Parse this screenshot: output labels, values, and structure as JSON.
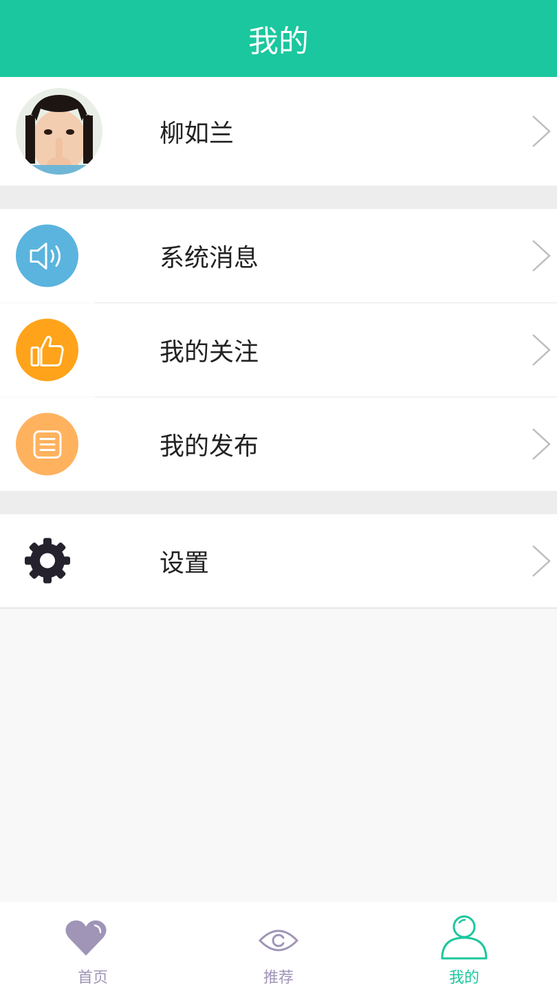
{
  "header": {
    "title": "我的"
  },
  "profile": {
    "name": "柳如兰"
  },
  "menu": [
    {
      "label": "系统消息",
      "icon": "speaker-icon",
      "color": "#5ab4de"
    },
    {
      "label": "我的关注",
      "icon": "thumbs-up-icon",
      "color": "#ffa31a"
    },
    {
      "label": "我的发布",
      "icon": "document-icon",
      "color": "#ffb25e"
    }
  ],
  "settings": {
    "label": "设置",
    "icon": "gear-icon"
  },
  "tabs": [
    {
      "label": "首页",
      "icon": "heart-icon",
      "active": false
    },
    {
      "label": "推荐",
      "icon": "eye-icon",
      "active": false
    },
    {
      "label": "我的",
      "icon": "user-icon",
      "active": true
    }
  ],
  "colors": {
    "accent": "#1bc79e",
    "inactive_tab": "#a094b7"
  }
}
